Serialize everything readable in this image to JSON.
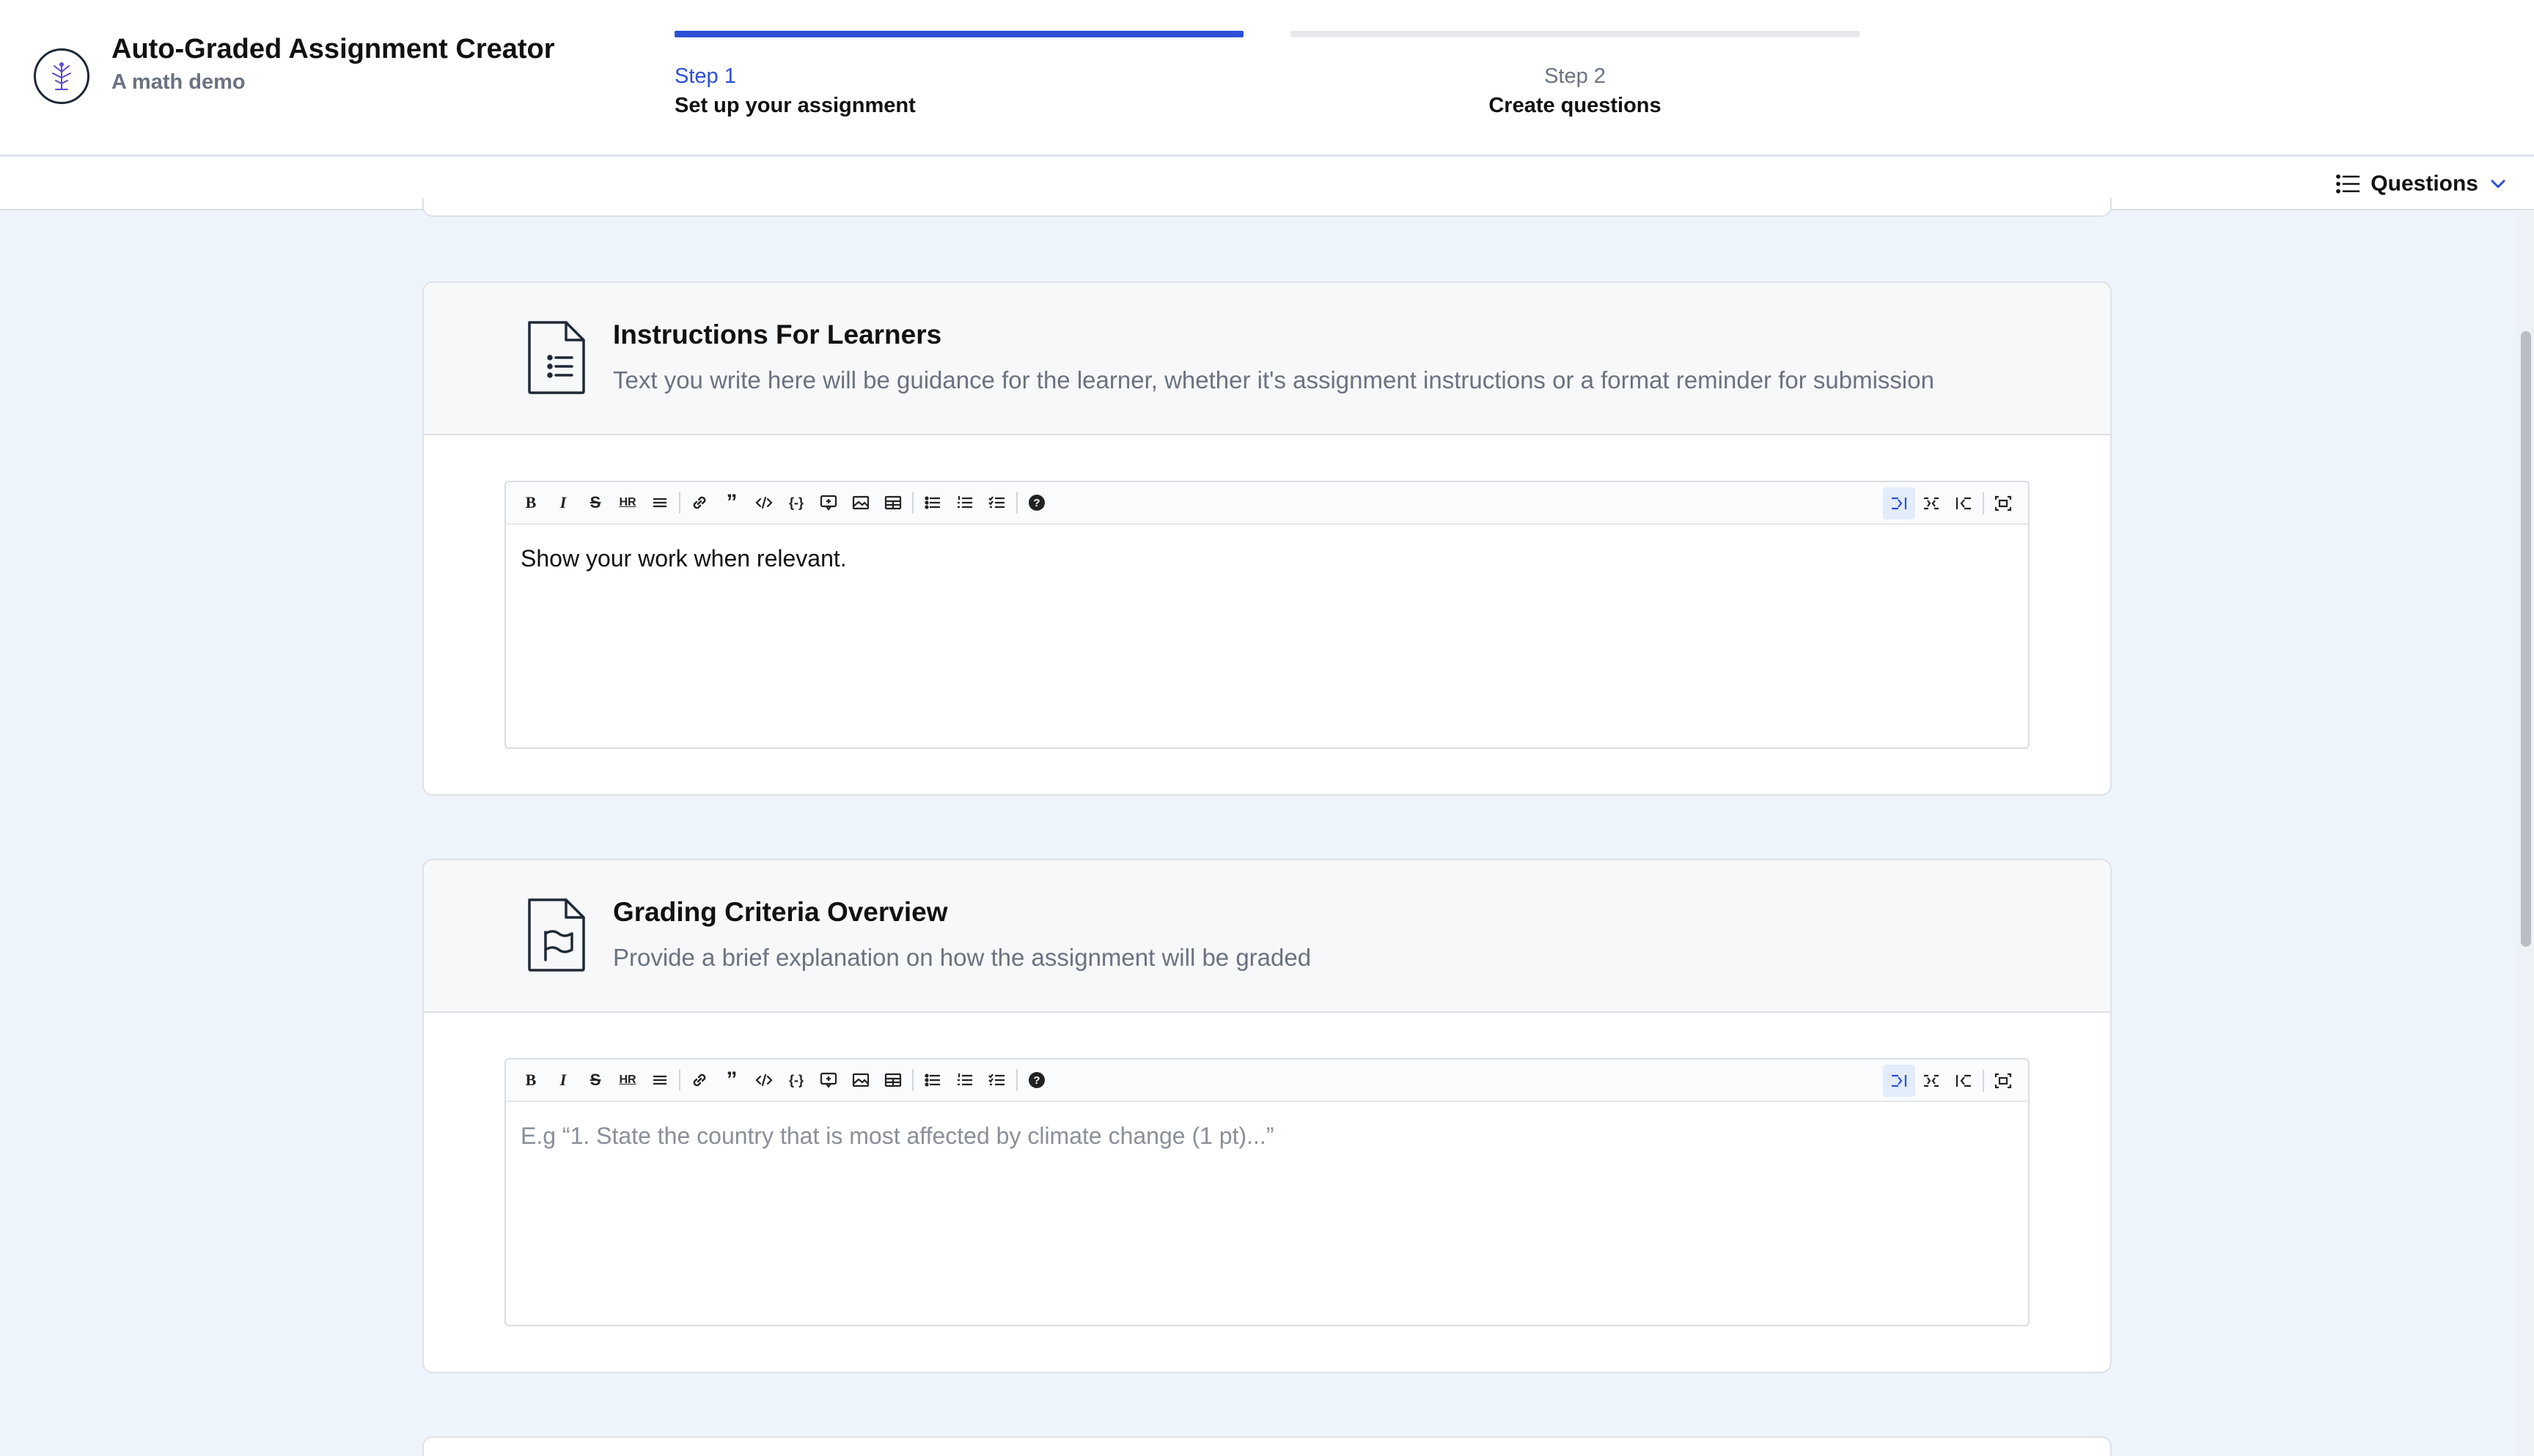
{
  "app": {
    "title": "Auto-Graded Assignment Creator",
    "subtitle": "A math demo",
    "icon": "tree-logo-icon"
  },
  "steps": [
    {
      "number": "Step 1",
      "name": "Set up your assignment",
      "active": true
    },
    {
      "number": "Step 2",
      "name": "Create questions",
      "active": false
    }
  ],
  "subbar": {
    "questions_label": "Questions",
    "icons": [
      "list-icon",
      "chevron-down-icon"
    ]
  },
  "cards": [
    {
      "title": "Instructions For Learners",
      "description": "Text you write here will be guidance for the learner, whether it's assignment instructions or a format reminder for submission",
      "icon": "document-list-icon",
      "editor_value": "Show your work when relevant.",
      "editor_placeholder": ""
    },
    {
      "title": "Grading Criteria Overview",
      "description": "Provide a brief explanation on how the assignment will be graded",
      "icon": "document-flag-icon",
      "editor_value": "",
      "editor_placeholder": "E.g “1. State the country that is most affected by climate change (1 pt)...”"
    }
  ],
  "toolbar": {
    "left_buttons": [
      "bold",
      "italic",
      "strikethrough",
      "horizontal-rule",
      "heading",
      "link",
      "quote",
      "code",
      "code-block",
      "comment",
      "image",
      "table",
      "bullet-list",
      "ordered-list",
      "task-list",
      "help"
    ],
    "right_buttons": [
      "edit-mode",
      "live-mode",
      "preview-mode",
      "fullscreen"
    ],
    "hr_label": "HR",
    "colors": {
      "accent": "#2d4fd6"
    }
  }
}
